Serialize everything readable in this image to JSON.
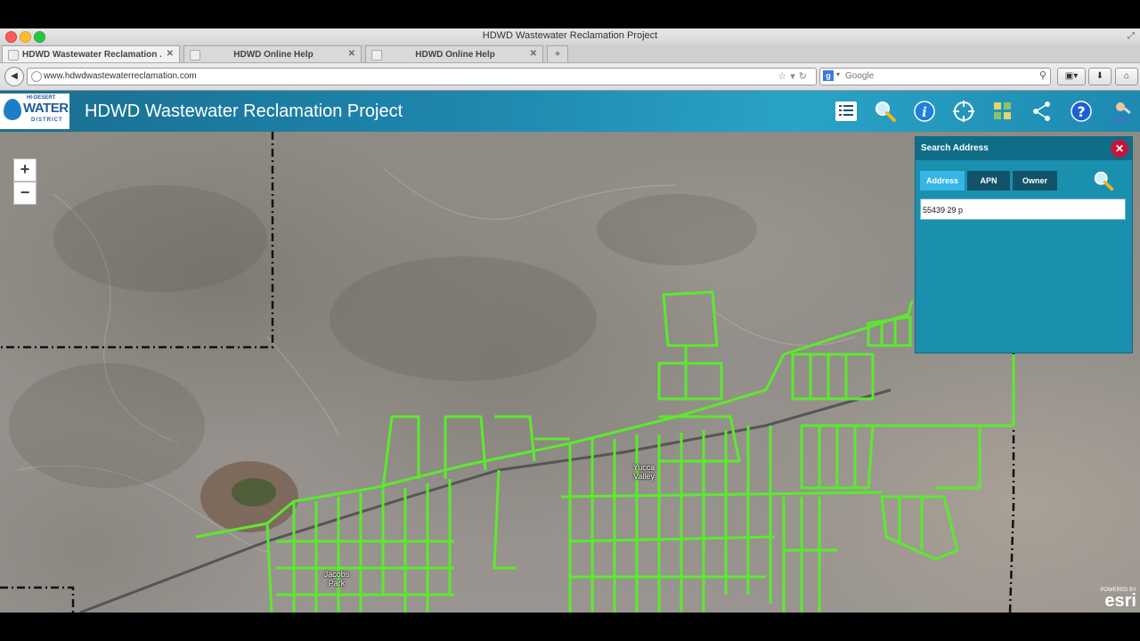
{
  "window": {
    "title": "HDWD Wastewater Reclamation Project"
  },
  "tabs": [
    {
      "label": "HDWD Wastewater Reclamation ..."
    },
    {
      "label": "HDWD Online Help"
    },
    {
      "label": "HDWD Online Help"
    }
  ],
  "toolbar": {
    "url": "www.hdwdwastewaterreclamation.com",
    "search_placeholder": "Google"
  },
  "app": {
    "logo": {
      "line1": "HI-DESERT",
      "line2": "WATER",
      "line3": "DISTRICT"
    },
    "title": "HDWD Wastewater Reclamation Project",
    "header_icons": [
      "list-icon",
      "search-icon",
      "info-icon",
      "locate-icon",
      "basemap-grid-icon",
      "share-icon",
      "help-icon",
      "user-tools-icon"
    ]
  },
  "map": {
    "zoom_in": "+",
    "zoom_out": "−",
    "labels": {
      "yucca_valley": "Yucca Valley",
      "jacobs_park": "Jacobs Park"
    },
    "attribution_small": "POWERED BY",
    "attribution": "esri",
    "colors": {
      "sewer_lines": "#5bea2e",
      "boundary": "#111111"
    }
  },
  "search_panel": {
    "title": "Search Address",
    "tabs": [
      {
        "label": "Address",
        "active": true
      },
      {
        "label": "APN"
      },
      {
        "label": "Owner"
      }
    ],
    "input_value": "55439 29 p",
    "accent": "#35b6e6"
  }
}
